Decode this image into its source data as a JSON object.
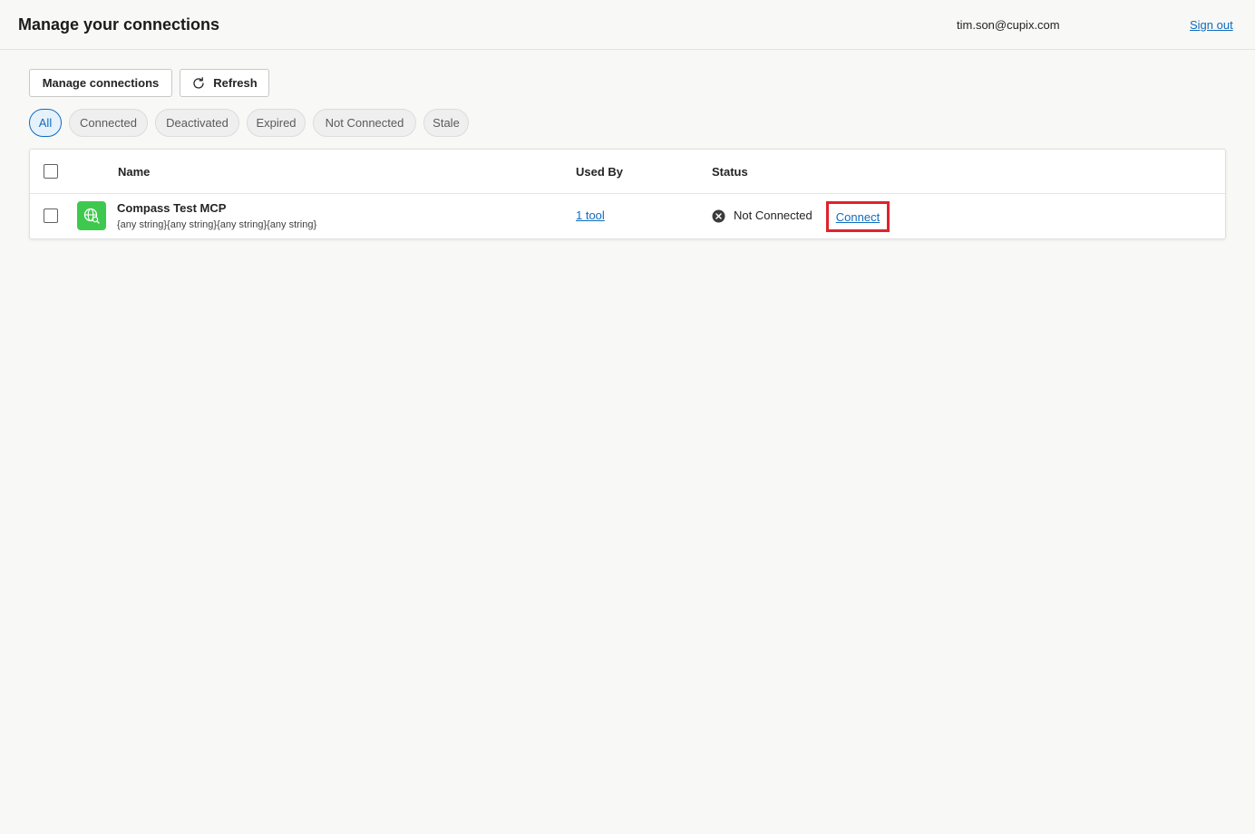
{
  "header": {
    "title": "Manage your connections",
    "user_email": "tim.son@cupix.com",
    "sign_out": "Sign out"
  },
  "toolbar": {
    "manage_label": "Manage connections",
    "refresh_label": "Refresh"
  },
  "filters": [
    "All",
    "Connected",
    "Deactivated",
    "Expired",
    "Not Connected",
    "Stale"
  ],
  "active_filter": "All",
  "table": {
    "columns": {
      "name": "Name",
      "used_by": "Used By",
      "status": "Status"
    },
    "rows": [
      {
        "name": "Compass Test MCP",
        "subtitle": "{any string}{any string}{any string}{any string}",
        "used_by": "1 tool",
        "status": "Not Connected",
        "action": "Connect",
        "icon": "globe-search-icon"
      }
    ]
  },
  "colors": {
    "accent": "#0f6cbd",
    "app_icon_bg": "#3ec94e",
    "highlight_border": "#e0222c"
  }
}
